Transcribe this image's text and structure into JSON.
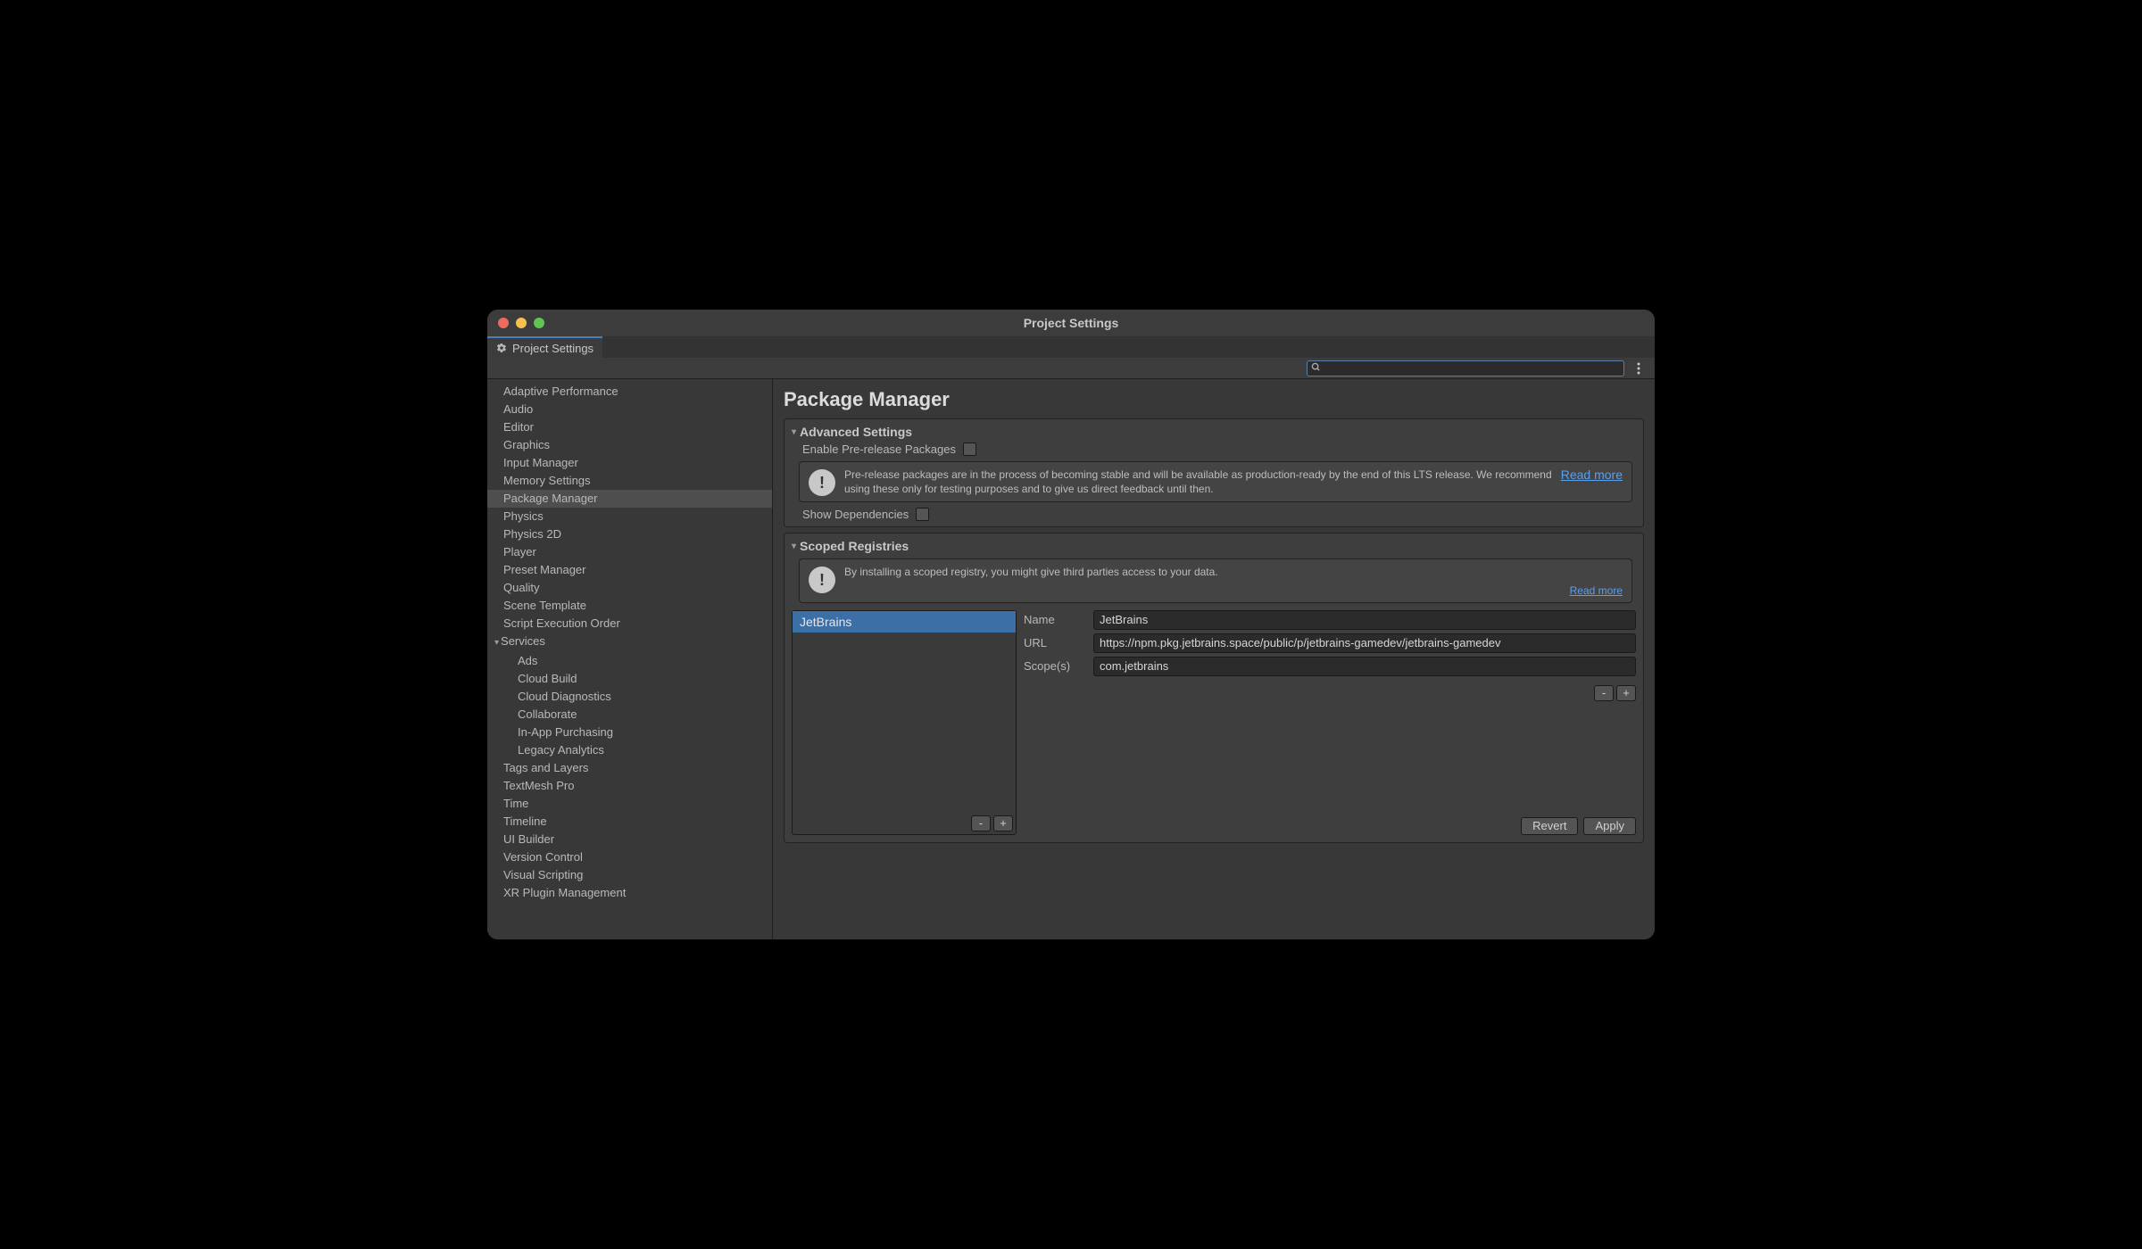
{
  "window": {
    "title": "Project Settings"
  },
  "tab": {
    "label": "Project Settings"
  },
  "sidebar": {
    "items": [
      {
        "label": "Adaptive Performance",
        "kind": "item"
      },
      {
        "label": "Audio",
        "kind": "item"
      },
      {
        "label": "Editor",
        "kind": "item"
      },
      {
        "label": "Graphics",
        "kind": "item"
      },
      {
        "label": "Input Manager",
        "kind": "item"
      },
      {
        "label": "Memory Settings",
        "kind": "item"
      },
      {
        "label": "Package Manager",
        "kind": "item",
        "selected": true
      },
      {
        "label": "Physics",
        "kind": "item"
      },
      {
        "label": "Physics 2D",
        "kind": "item"
      },
      {
        "label": "Player",
        "kind": "item"
      },
      {
        "label": "Preset Manager",
        "kind": "item"
      },
      {
        "label": "Quality",
        "kind": "item"
      },
      {
        "label": "Scene Template",
        "kind": "item"
      },
      {
        "label": "Script Execution Order",
        "kind": "item"
      },
      {
        "label": "Services",
        "kind": "parent"
      },
      {
        "label": "Ads",
        "kind": "child"
      },
      {
        "label": "Cloud Build",
        "kind": "child"
      },
      {
        "label": "Cloud Diagnostics",
        "kind": "child"
      },
      {
        "label": "Collaborate",
        "kind": "child"
      },
      {
        "label": "In-App Purchasing",
        "kind": "child"
      },
      {
        "label": "Legacy Analytics",
        "kind": "child"
      },
      {
        "label": "Tags and Layers",
        "kind": "item"
      },
      {
        "label": "TextMesh Pro",
        "kind": "item"
      },
      {
        "label": "Time",
        "kind": "item"
      },
      {
        "label": "Timeline",
        "kind": "item"
      },
      {
        "label": "UI Builder",
        "kind": "item"
      },
      {
        "label": "Version Control",
        "kind": "item"
      },
      {
        "label": "Visual Scripting",
        "kind": "item"
      },
      {
        "label": "XR Plugin Management",
        "kind": "item"
      }
    ]
  },
  "main": {
    "title": "Package Manager",
    "advanced": {
      "header": "Advanced Settings",
      "enable_pre_label": "Enable Pre-release Packages",
      "pre_info": "Pre-release packages are in the process of becoming stable and will be available as production-ready by the end of this LTS release. We recommend using these only for testing purposes and to give us direct feedback until then.",
      "read_more": "Read more",
      "show_deps_label": "Show Dependencies"
    },
    "scoped": {
      "header": "Scoped Registries",
      "warn": "By installing a scoped registry, you might give third parties access to your data.",
      "read_more": "Read more",
      "registries": [
        {
          "name": "JetBrains"
        }
      ],
      "form": {
        "name_label": "Name",
        "name_value": "JetBrains",
        "url_label": "URL",
        "url_value": "https://npm.pkg.jetbrains.space/public/p/jetbrains-gamedev/jetbrains-gamedev",
        "scopes_label": "Scope(s)",
        "scope_value": "com.jetbrains"
      },
      "buttons": {
        "minus": "-",
        "plus": "+",
        "revert": "Revert",
        "apply": "Apply"
      }
    }
  }
}
